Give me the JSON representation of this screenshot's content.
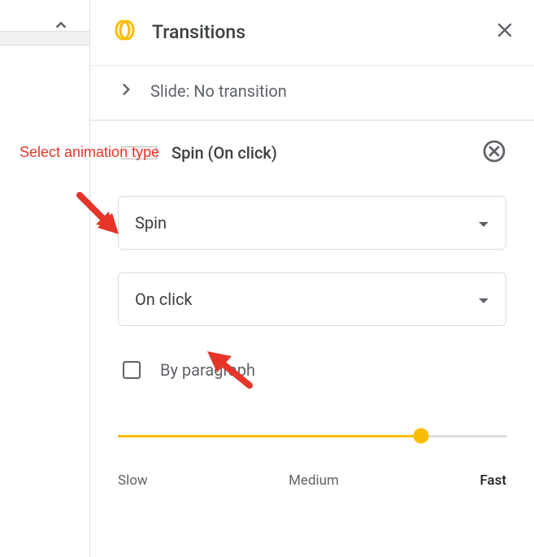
{
  "annotation": {
    "label": "Select animation type"
  },
  "panel": {
    "title": "Transitions"
  },
  "slide": {
    "label": "Slide: No transition"
  },
  "animation": {
    "title": "Spin  (On click)",
    "type_dropdown": "Spin",
    "trigger_dropdown": "On click",
    "by_paragraph_label": "By paragraph"
  },
  "speed": {
    "slow": "Slow",
    "medium": "Medium",
    "fast": "Fast"
  },
  "colors": {
    "accent": "#fbbc04",
    "annotation": "#e53528"
  }
}
